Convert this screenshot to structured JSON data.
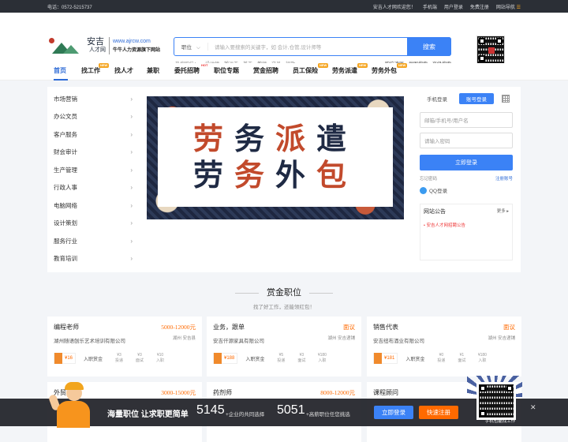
{
  "topbar": {
    "phone": "电话：0572-5215737",
    "welcome": "安吉人才网欢迎您！",
    "mobile": "手机端",
    "user_login": "用户登录",
    "free_register": "免费注册",
    "site_nav": "网站导航"
  },
  "logo": {
    "brand": "安吉",
    "brand_sub": "人才网",
    "site": "www.ajrcw.com",
    "slogan": "牛牛人力资源旗下网站"
  },
  "search": {
    "select": "职位",
    "placeholder": "请输入要搜索的关键字，如 会计,仓管,设计师等",
    "button": "搜索"
  },
  "hot": {
    "label": "热搜职位：",
    "items": [
      "设计师",
      "搬运工",
      "普工",
      "教师",
      "文员",
      "行政"
    ]
  },
  "links": [
    "职位速历",
    "地图搜索",
    "高级搜索"
  ],
  "nav": {
    "items": [
      {
        "label": "首页"
      },
      {
        "label": "找工作",
        "tag": "NEW"
      },
      {
        "label": "找人才"
      },
      {
        "label": "兼职"
      },
      {
        "label": "委托招聘",
        "tag": "HOT"
      },
      {
        "label": "职位专题"
      },
      {
        "label": "赏金招聘"
      },
      {
        "label": "员工保险",
        "tag": "NEW"
      },
      {
        "label": "劳务派遣",
        "tag": "NEW"
      },
      {
        "label": "劳务外包",
        "tag": "NEW"
      }
    ]
  },
  "categories": [
    "市场营销",
    "办公文员",
    "客户服务",
    "财会审计",
    "生产管理",
    "行政人事",
    "电脑网络",
    "设计策划",
    "服务行业",
    "教育培训"
  ],
  "banner": {
    "line1": "劳务派遣",
    "line2": "劳务外包"
  },
  "login": {
    "tab_mobile": "手机登录",
    "tab_account": "账号登录",
    "username_ph": "邮箱/手机号/用户名",
    "password_ph": "请输入密码",
    "button": "立即登录",
    "forgot": "忘记密码",
    "register": "注册账号",
    "qq": "QQ登录"
  },
  "notice": {
    "title": "网站公告",
    "more": "更多",
    "item": "安吉人才网招聘公告"
  },
  "section": {
    "title": "赏金职位",
    "subtitle": "找了好工作，还能领红包！"
  },
  "jobs": [
    {
      "title": "编程老师",
      "salary": "5000-12000元",
      "company": "湖州随语刨乐艺术培训有限公司",
      "location": "湖州 安吉县",
      "bonus": "¥16",
      "bonus_label": "入职赏金",
      "stats": [
        {
          "v": "¥3",
          "l": "投递"
        },
        {
          "v": "¥3",
          "l": "面试"
        },
        {
          "v": "¥10",
          "l": "入职"
        }
      ]
    },
    {
      "title": "业务，跟单",
      "salary": "面议",
      "company": "安吉仟源家具有限公司",
      "location": "湖州 安吉递铺",
      "bonus": "¥188",
      "bonus_label": "入职赏金",
      "stats": [
        {
          "v": "¥5",
          "l": "投递"
        },
        {
          "v": "¥3",
          "l": "面试"
        },
        {
          "v": "¥180",
          "l": "入职"
        }
      ]
    },
    {
      "title": "销售代表",
      "salary": "面议",
      "company": "安吉纽布酒业有限公司",
      "location": "湖州 安吉递铺",
      "bonus": "¥181",
      "bonus_label": "入职赏金",
      "stats": [
        {
          "v": "¥0",
          "l": "投递"
        },
        {
          "v": "¥1",
          "l": "面试"
        },
        {
          "v": "¥180",
          "l": "入职"
        }
      ]
    },
    {
      "title": "外贸",
      "salary": "3000-15000元"
    },
    {
      "title": "药剂师",
      "salary": "8000-12000元"
    },
    {
      "title": "课程顾问",
      "salary": ""
    }
  ],
  "bottombar": {
    "title": "海量职位 让求职更简单",
    "num1": "5145",
    "label1": "+企业的共同选择",
    "num2": "5051",
    "label2": "+高薪职位任您挑选",
    "login": "立即登录",
    "register": "快速注册",
    "qr_text": "手机也能找工作",
    "close": "✕"
  }
}
